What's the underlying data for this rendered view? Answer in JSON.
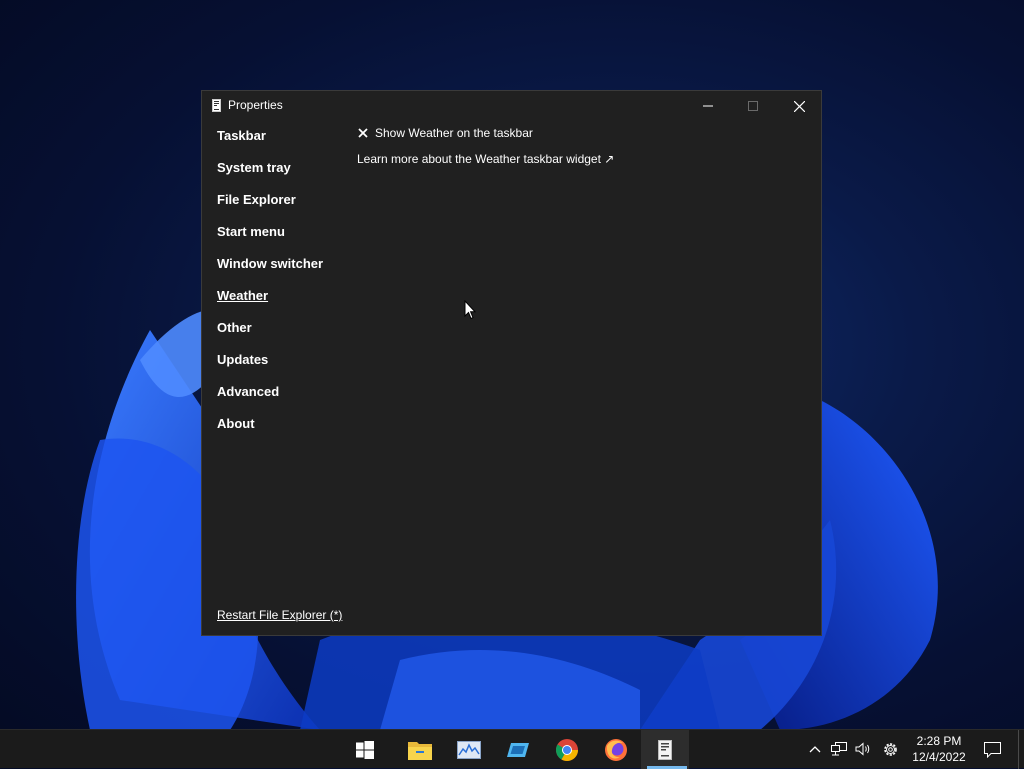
{
  "window": {
    "title": "Properties",
    "minimize_icon": "minimize-icon",
    "maximize_icon": "maximize-icon",
    "close_icon": "close-icon"
  },
  "nav": {
    "items": [
      {
        "label": "Taskbar"
      },
      {
        "label": "System tray"
      },
      {
        "label": "File Explorer"
      },
      {
        "label": "Start menu"
      },
      {
        "label": "Window switcher"
      },
      {
        "label": "Weather"
      },
      {
        "label": "Other"
      },
      {
        "label": "Updates"
      },
      {
        "label": "Advanced"
      },
      {
        "label": "About"
      }
    ],
    "selected": "Weather"
  },
  "content": {
    "show_weather": {
      "label": "Show Weather on the taskbar",
      "checked": false
    },
    "learn_more": "Learn more about the Weather taskbar widget ↗"
  },
  "footer": {
    "restart_label": "Restart File Explorer (*)"
  },
  "taskbar": {
    "apps": [
      "start-icon",
      "file-explorer-icon",
      "resource-monitor-icon",
      "app-icon",
      "chrome-icon",
      "firefox-icon",
      "properties-app-icon"
    ],
    "clock": {
      "time": "2:28 PM",
      "date": "12/4/2022"
    }
  },
  "colors": {
    "window_bg": "#202020",
    "taskbar_bg": "#1b1b1b",
    "accent": "#76b9ed"
  }
}
